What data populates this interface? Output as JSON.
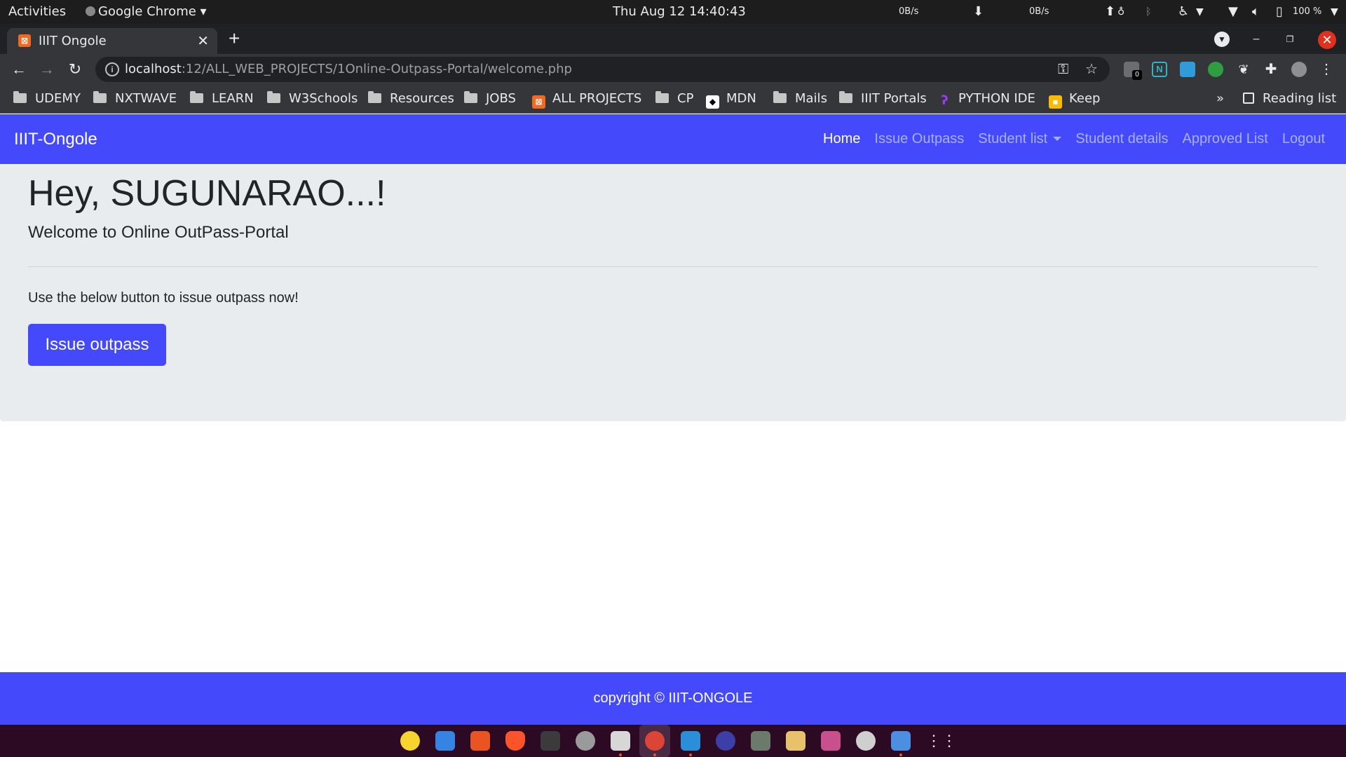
{
  "system_bar": {
    "activities": "Activities",
    "app": "Google Chrome",
    "datetime": "Thu Aug 12  14:40:43",
    "net_down": "0B/s",
    "net_up": "0B/s",
    "battery": "100 %"
  },
  "browser": {
    "tab_title": "IIIT Ongole",
    "url_host": "localhost",
    "url_path": ":12/ALL_WEB_PROJECTS/1Online-Outpass-Portal/welcome.php",
    "bookmarks": [
      {
        "label": "UDEMY",
        "icon": "folder-icon"
      },
      {
        "label": "NXTWAVE",
        "icon": "folder-icon"
      },
      {
        "label": "LEARN",
        "icon": "folder-icon"
      },
      {
        "label": "W3Schools",
        "icon": "folder-icon"
      },
      {
        "label": "Resources",
        "icon": "folder-icon"
      },
      {
        "label": "JOBS",
        "icon": "folder-icon"
      },
      {
        "label": "ALL PROJECTS",
        "icon": "xampp-icon"
      },
      {
        "label": "CP",
        "icon": "folder-icon"
      },
      {
        "label": "MDN",
        "icon": "mdn-icon"
      },
      {
        "label": "Mails",
        "icon": "folder-icon"
      },
      {
        "label": "IIIT Portals",
        "icon": "folder-icon"
      },
      {
        "label": "PYTHON IDE",
        "icon": "python-icon"
      },
      {
        "label": "Keep",
        "icon": "keep-icon"
      }
    ],
    "more": "»",
    "reading_list": "Reading list",
    "extension_badge": "0"
  },
  "site": {
    "brand": "IIIT-Ongole",
    "nav": {
      "home": "Home",
      "issue": "Issue Outpass",
      "students": "Student list",
      "details": "Student details",
      "approved": "Approved List",
      "logout": "Logout"
    },
    "hero": {
      "title": "Hey, SUGUNARAO...!",
      "subtitle": "Welcome to Online OutPass-Portal",
      "text": "Use the below button to issue outpass now!",
      "button": "Issue outpass"
    },
    "footer": "copyright © IIIT-ONGOLE"
  },
  "colors": {
    "brand_blue": "#4449fb",
    "jumbotron": "#e9ecef",
    "topbar": "#1d1d1d",
    "dock": "#2c0a24"
  }
}
